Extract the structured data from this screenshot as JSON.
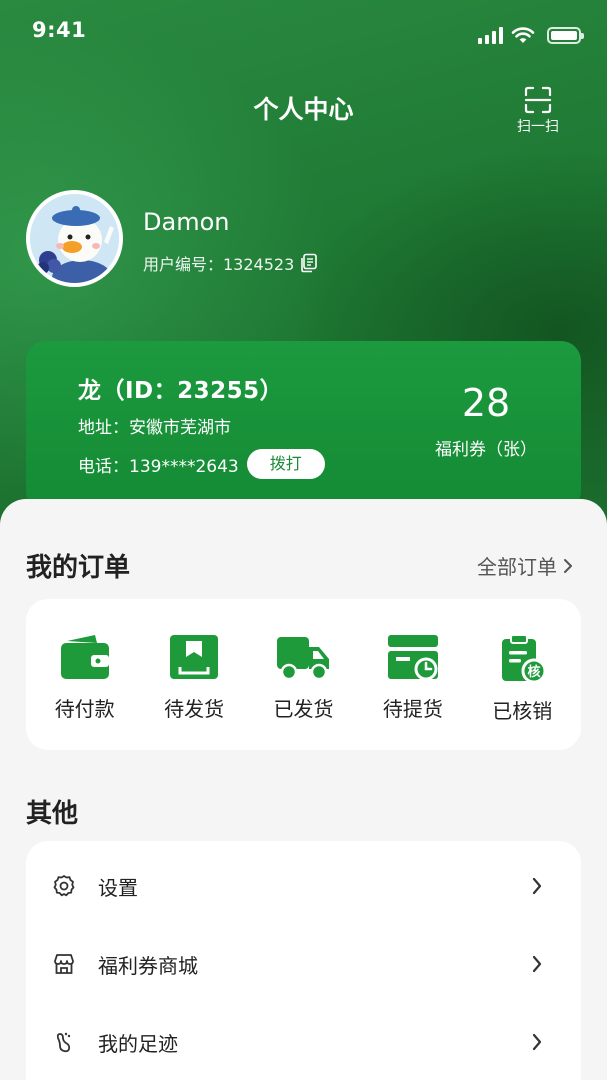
{
  "status_bar": {
    "time": "9:41"
  },
  "header": {
    "title": "个人中心",
    "scan_label": "扫一扫"
  },
  "user": {
    "name": "Damon",
    "id_label": "用户编号：1324523"
  },
  "store": {
    "name": "龙（ID：23255）",
    "address": "地址：安徽市芜湖市",
    "phone": "电话：139****2643",
    "call_label": "拨打",
    "coupon_count": "28",
    "coupon_label": "福利券（张）"
  },
  "orders": {
    "title": "我的订单",
    "all_label": "全部订单",
    "items": [
      {
        "label": "待付款",
        "icon": "wallet-icon"
      },
      {
        "label": "待发货",
        "icon": "package-icon"
      },
      {
        "label": "已发货",
        "icon": "truck-icon"
      },
      {
        "label": "待提货",
        "icon": "pickup-icon"
      },
      {
        "label": "已核销",
        "icon": "verified-clipboard-icon"
      }
    ],
    "verify_badge": "核"
  },
  "others": {
    "title": "其他",
    "items": [
      {
        "label": "设置",
        "icon": "gear-icon"
      },
      {
        "label": "福利券商城",
        "icon": "store-icon"
      },
      {
        "label": "我的足迹",
        "icon": "footprint-icon"
      }
    ]
  },
  "colors": {
    "brand_green": "#1e8c3a",
    "icon_green": "#1f9a3a"
  }
}
